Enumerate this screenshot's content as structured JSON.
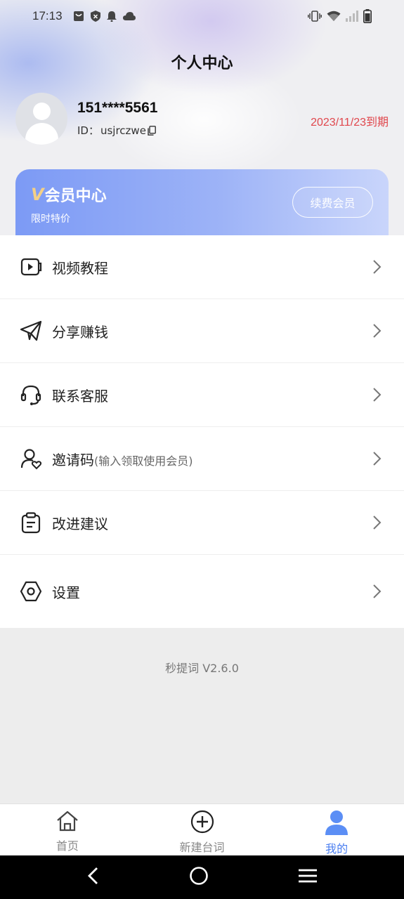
{
  "status_bar": {
    "time": "17:13",
    "icons": [
      "shopping-bag-icon",
      "shield-icon",
      "bell-icon",
      "cloud-icon",
      "vibrate-icon",
      "wifi-icon",
      "signal-icon",
      "battery-icon"
    ]
  },
  "header": {
    "title": "个人中心"
  },
  "profile": {
    "phone": "151****5561",
    "id_label": "ID：",
    "id_value": "usjrczwe",
    "expire": "2023/11/23到期"
  },
  "vip": {
    "badge": "V",
    "title": "会员中心",
    "subtitle": "限时特价",
    "renew_label": "续费会员"
  },
  "menu": {
    "items": [
      {
        "label": "视频教程",
        "hint": "",
        "icon": "video-play-icon"
      },
      {
        "label": "分享赚钱",
        "hint": "",
        "icon": "paper-plane-icon"
      },
      {
        "label": "联系客服",
        "hint": "",
        "icon": "headset-icon"
      },
      {
        "label": "邀请码",
        "hint": "(输入领取使用会员)",
        "icon": "user-heart-icon"
      },
      {
        "label": "改进建议",
        "hint": "",
        "icon": "clipboard-icon"
      },
      {
        "label": "设置",
        "hint": "",
        "icon": "hexagon-settings-icon"
      }
    ]
  },
  "version": "秒提词 V2.6.0",
  "tabbar": {
    "tabs": [
      {
        "label": "首页",
        "icon": "home-icon"
      },
      {
        "label": "新建台词",
        "icon": "plus-circle-icon"
      },
      {
        "label": "我的",
        "icon": "user-icon"
      }
    ],
    "active_index": 2
  },
  "colors": {
    "accent": "#4a7ef0",
    "expire_red": "#e0464c",
    "vip_gradient_start": "#7c9af5",
    "vip_gradient_end": "#c9d5fb"
  },
  "nav_icons": [
    "back-icon",
    "home-circle-icon",
    "menu-icon"
  ]
}
